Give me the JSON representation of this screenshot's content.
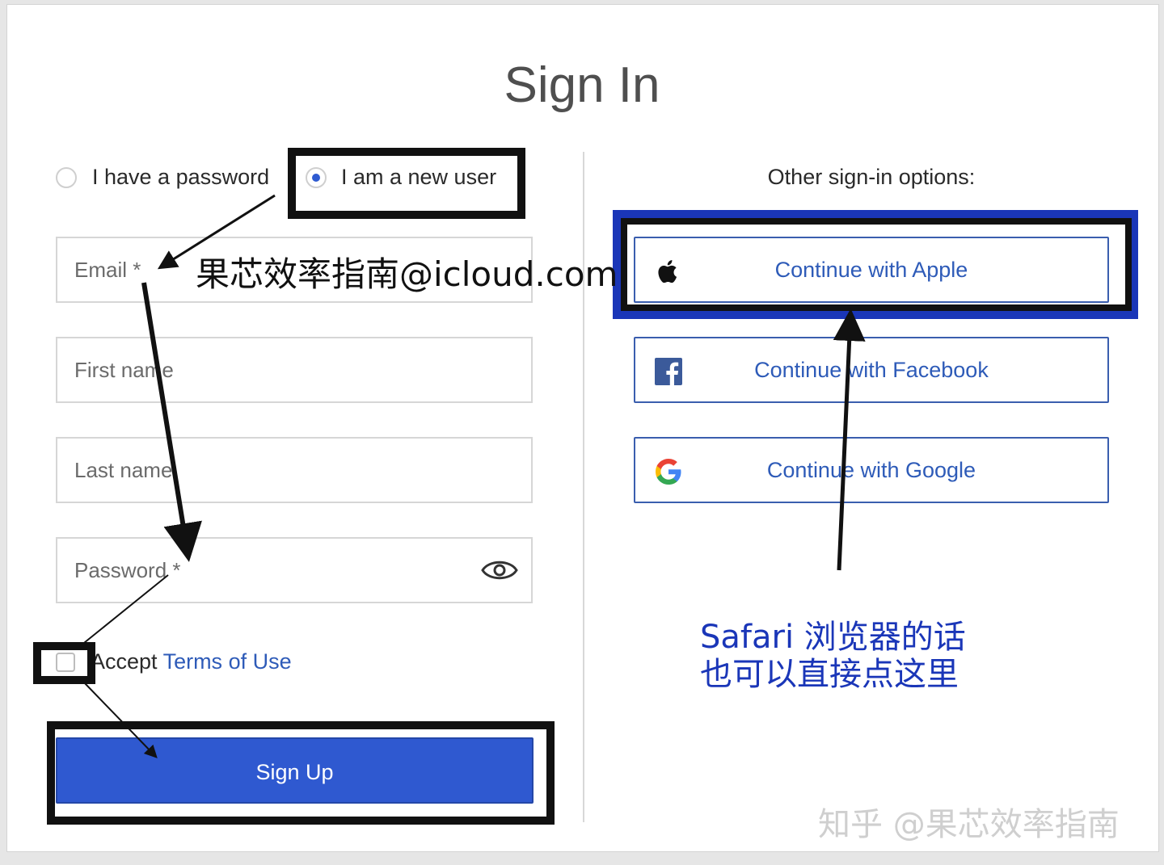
{
  "page_title": "Sign In",
  "auth_mode": {
    "options": [
      {
        "label": "I have a password",
        "checked": false
      },
      {
        "label": "I am a new user",
        "checked": true
      }
    ]
  },
  "form": {
    "email_placeholder": "Email *",
    "first_name_placeholder": "First name",
    "last_name_placeholder": "Last name",
    "password_placeholder": "Password *",
    "password_toggle_icon": "eye-icon",
    "accept_prefix": "Accept ",
    "accept_link": "Terms of Use",
    "accept_checked": false,
    "submit_label": "Sign Up"
  },
  "other_options": {
    "heading": "Other sign-in options:",
    "buttons": [
      {
        "label": "Continue with Apple",
        "icon": "apple-icon"
      },
      {
        "label": "Continue with Facebook",
        "icon": "facebook-icon"
      },
      {
        "label": "Continue with Google",
        "icon": "google-icon"
      }
    ]
  },
  "annotations": {
    "email_hint": "果芯效率指南@icloud.com",
    "safari_line1": "Safari 浏览器的话",
    "safari_line2": "也可以直接点这里",
    "watermark": "知乎 @果芯效率指南"
  },
  "colors": {
    "accent": "#2f59d0",
    "link": "#2e5bb8",
    "highlight_black": "#111111",
    "highlight_blue": "#1a36b8"
  }
}
